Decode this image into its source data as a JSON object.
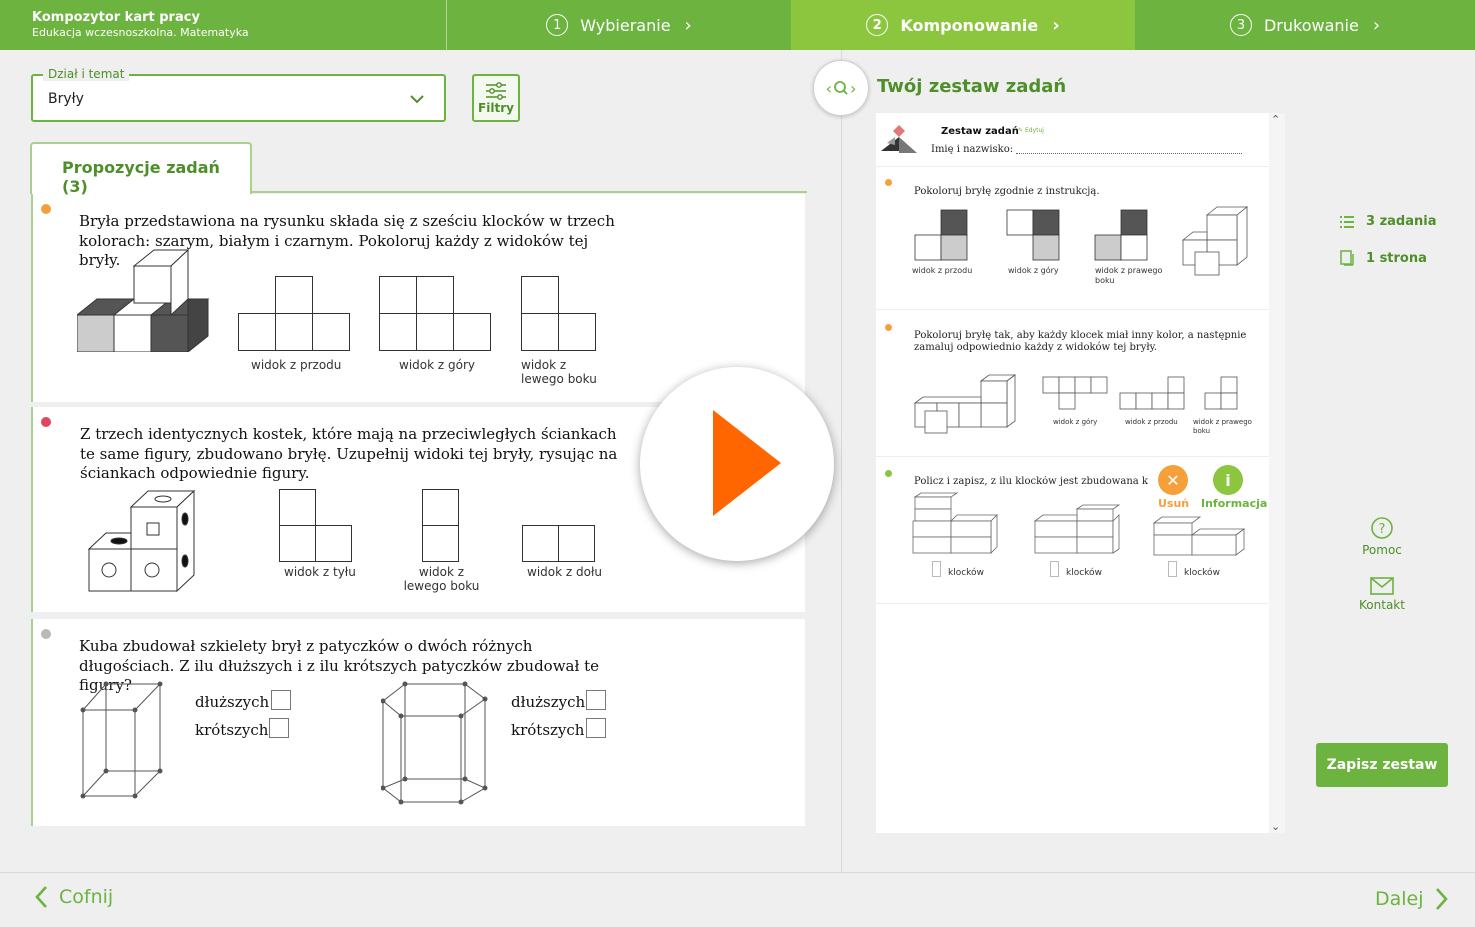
{
  "header": {
    "app_title": "Kompozytor kart pracy",
    "app_subtitle": "Edukacja wczesnoszkolna. Matematyka",
    "steps": [
      {
        "num": "1",
        "label": "Wybieranie"
      },
      {
        "num": "2",
        "label": "Komponowanie"
      },
      {
        "num": "3",
        "label": "Drukowanie"
      }
    ],
    "active_step": 2
  },
  "filters": {
    "field_label": "Dział i temat",
    "field_value": "Bryły",
    "filter_button": "Filtry"
  },
  "proposals": {
    "tab_label": "Propozycje zadań (3)",
    "tasks": [
      {
        "dot_color": "#f5a03a",
        "text": "Bryła przedstawiona na rysunku składa się z sześciu klocków w trzech kolorach: szarym, białym i czarnym. Pokoloruj każdy z widoków tej bryły.",
        "captions": [
          "widok z przodu",
          "widok z góry",
          "widok z lewego boku"
        ]
      },
      {
        "dot_color": "#e0465e",
        "text": "Z trzech identycznych kostek, które mają na przeciwległych ściankach te same figury, zbudowano bryłę. Uzupełnij widoki tej bryły, rysując na ściankach odpowiednie figury.",
        "captions": [
          "widok z tyłu",
          "widok z lewego boku",
          "widok z dołu"
        ]
      },
      {
        "dot_color": "#b9b9b9",
        "text": "Kuba zbudował szkielety brył z patyczków o dwóch różnych długościach. Z ilu dłuższych i z ilu krótszych patyczków zbudował te figury?",
        "labels": [
          "dłuższych",
          "krótszych",
          "dłuższych",
          "krótszych"
        ]
      }
    ]
  },
  "set": {
    "title": "Twój zestaw zadań",
    "doc_title": "Zestaw zadań",
    "edit_label": "Edytuj",
    "name_label": "Imię i nazwisko:",
    "items": [
      {
        "dot_color": "#f5a03a",
        "text": "Pokoloruj bryłę zgodnie z instrukcją.",
        "captions": [
          "widok z przodu",
          "widok z góry",
          "widok z prawego boku"
        ]
      },
      {
        "dot_color": "#f5a03a",
        "text": "Pokoloruj bryłę tak, aby każdy klocek miał inny kolor, a następnie zamaluj odpowiednio każdy z widoków tej bryły.",
        "captions": [
          "widok z góry",
          "widok z przodu",
          "widok z prawego boku"
        ]
      },
      {
        "dot_color": "#8cc63f",
        "text": "Policz i zapisz, z ilu klocków jest zbudowana każda b",
        "captions": [
          "klocków",
          "klocków",
          "klocków"
        ],
        "remove_label": "Usuń",
        "info_label": "Informacja"
      }
    ],
    "stats": {
      "tasks": "3 zadania",
      "pages": "1 strona"
    },
    "help_label": "Pomoc",
    "contact_label": "Kontakt",
    "save_label": "Zapisz zestaw"
  },
  "footer": {
    "back_label": "Cofnij",
    "next_label": "Dalej"
  },
  "colors": {
    "primary": "#6cb33f",
    "active_step": "#8cc63f",
    "play": "#ff6600",
    "remove": "#f5a03a",
    "info": "#8cc63f"
  }
}
